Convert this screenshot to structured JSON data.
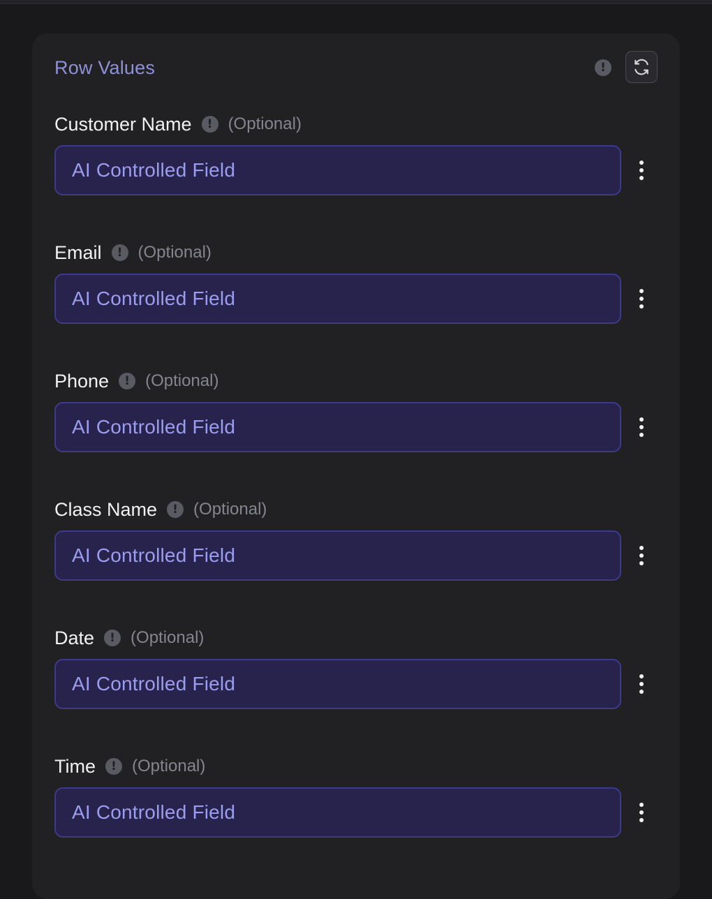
{
  "panel": {
    "title": "Row Values",
    "info_icon": "exclamation-circle-icon",
    "refresh_icon": "refresh-icon"
  },
  "fields": [
    {
      "label": "Customer Name",
      "optional_text": "(Optional)",
      "value": "AI Controlled Field"
    },
    {
      "label": "Email",
      "optional_text": "(Optional)",
      "value": "AI Controlled Field"
    },
    {
      "label": "Phone",
      "optional_text": "(Optional)",
      "value": "AI Controlled Field"
    },
    {
      "label": "Class Name",
      "optional_text": "(Optional)",
      "value": "AI Controlled Field"
    },
    {
      "label": "Date",
      "optional_text": "(Optional)",
      "value": "AI Controlled Field"
    },
    {
      "label": "Time",
      "optional_text": "(Optional)",
      "value": "AI Controlled Field"
    }
  ],
  "colors": {
    "page_background": "#19191c",
    "panel_background": "#212124",
    "accent_text": "#8f90d6",
    "input_background": "#27234d",
    "input_border": "#3f3a8a",
    "input_text": "#9c9cf0"
  }
}
